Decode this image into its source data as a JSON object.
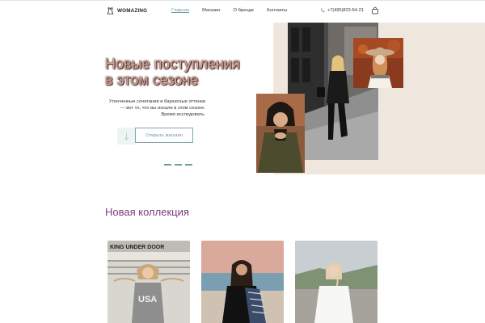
{
  "header": {
    "logo_text": "WOMAZING",
    "nav": [
      "Главная",
      "Магазин",
      "О бренде",
      "Контакты"
    ],
    "phone": "+7(495)823-54-21"
  },
  "hero": {
    "title_line1": "Новые поступления",
    "title_line2": "в этом сезоне",
    "subtitle": "Утонченные сочетания и бархатные оттенки — вот то, что вы искали в этом сезоне. Время исследовать.",
    "shop_button": "Открыть магазин",
    "slider_count": 3
  },
  "collection": {
    "title": "Новая коллекция",
    "card1_sign": "KING UNDER DOOR",
    "card1_shirt": "USA"
  },
  "colors": {
    "accent": "#6E9C9F",
    "section_title": "#7B3B7B",
    "beige": "#EFE7DD"
  }
}
